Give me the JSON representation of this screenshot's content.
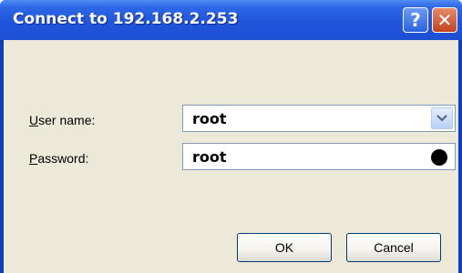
{
  "window": {
    "title": "Connect to 192.168.2.253",
    "help_label": "?",
    "close_label": "✕"
  },
  "form": {
    "username": {
      "label_accel": "U",
      "label_rest": "ser name:",
      "value": "root"
    },
    "password": {
      "label_accel": "P",
      "label_rest": "assword:",
      "value": "root"
    }
  },
  "buttons": {
    "ok": "OK",
    "cancel": "Cancel"
  },
  "icons": {
    "help": "question-mark-icon",
    "close": "close-icon",
    "dropdown": "chevron-down-icon",
    "password_indicator": "black-dot-icon"
  },
  "colors": {
    "titlebar": "#1f55dc",
    "dialog_background": "#ece9d8",
    "close_button": "#c2431c"
  }
}
